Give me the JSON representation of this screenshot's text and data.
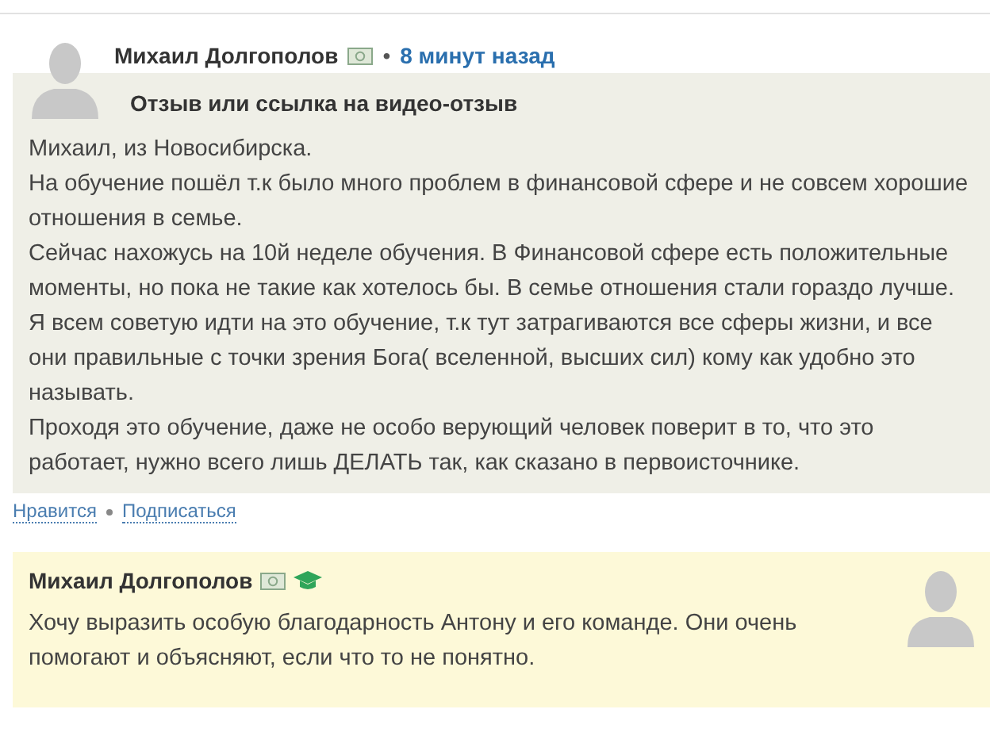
{
  "post": {
    "author": "Михаил Долгополов",
    "separator": "•",
    "time": "8 минут назад",
    "title": "Отзыв или ссылка на видео-отзыв",
    "paragraphs": [
      "Михаил, из Новосибирска.",
      "На обучение пошёл т.к было много проблем в финансовой сфере и не совсем хорошие отношения в семье.",
      "Сейчас нахожусь на 10й неделе обучения. В Финансовой сфере есть положительные моменты, но пока не такие как хотелось бы. В семье отношения стали гораздо лучше.",
      "Я всем советую идти на это обучение, т.к тут затрагиваются все сферы жизни, и все они правильные с точки зрения Бога( вселенной, высших сил) кому как удобно это называть.",
      "Проходя это обучение, даже не особо верующий человек поверит в то, что это работает, нужно всего лишь ДЕЛАТЬ так, как сказано в первоисточнике."
    ],
    "actions": [
      "Нравится",
      "Подписаться"
    ]
  },
  "reply": {
    "author": "Михаил Долгополов",
    "graduate": true,
    "text": "Хочу выразить особую благодарность Антону и его команде. Они очень помогают и объясняют, если что то не понятно."
  }
}
